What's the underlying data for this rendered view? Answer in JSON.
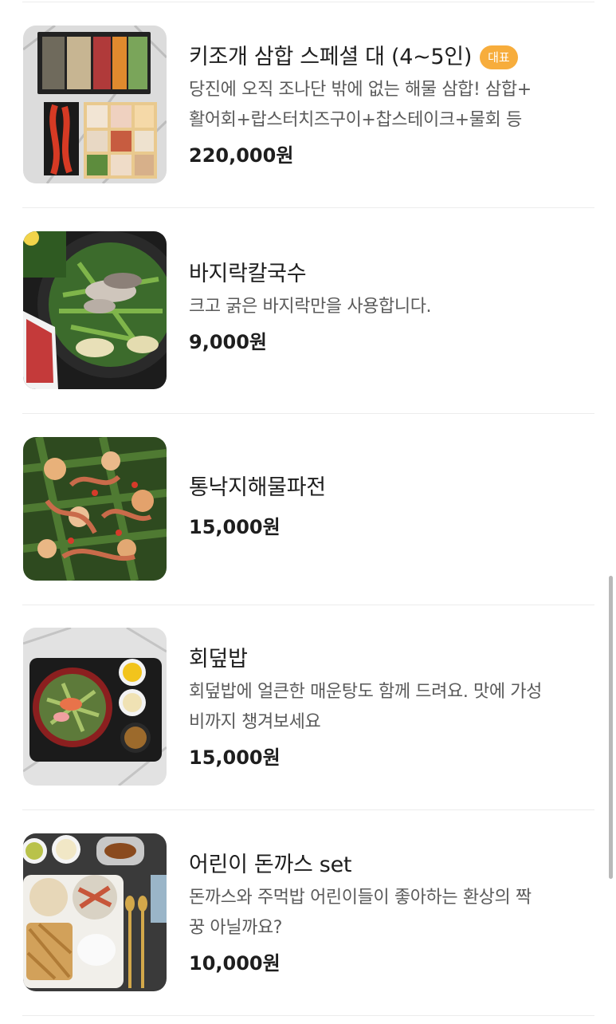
{
  "menu": {
    "items": [
      {
        "name": "키조개 삼합 스페셜 대 (4~5인)",
        "badge": "대표",
        "desc_lines": [
          "당진에 오직 조나단 밖에 없는 해물 삼합! 삼합+",
          "활어회+랍스터치즈구이+찹스테이크+물회 등"
        ],
        "price": "220,000원",
        "image": "seafood-platter-photo"
      },
      {
        "name": "바지락칼국수",
        "desc_lines": [
          "크고 굵은 바지락만을 사용합니다."
        ],
        "price": "9,000원",
        "image": "noodle-hotpot-photo"
      },
      {
        "name": "통낙지해물파전",
        "desc_lines": [],
        "price": "15,000원",
        "image": "seafood-pancake-photo"
      },
      {
        "name": "회덮밥",
        "desc_lines": [
          "회덮밥에 얼큰한 매운탕도 함께 드려요. 맛에 가성",
          "비까지 챙겨보세요"
        ],
        "price": "15,000원",
        "image": "raw-fish-bibimbap-photo"
      },
      {
        "name": "어린이 돈까스 set",
        "desc_lines": [
          "돈까스와 주먹밥 어린이들이 좋아하는 환상의 짝",
          "꿍 아닐까요?"
        ],
        "price": "10,000원",
        "image": "kids-pork-cutlet-photo"
      }
    ]
  },
  "colors": {
    "badge": "#f7ad3c",
    "divider": "#ececec",
    "price": "#1e1e1e",
    "description": "#5a5a5a"
  }
}
